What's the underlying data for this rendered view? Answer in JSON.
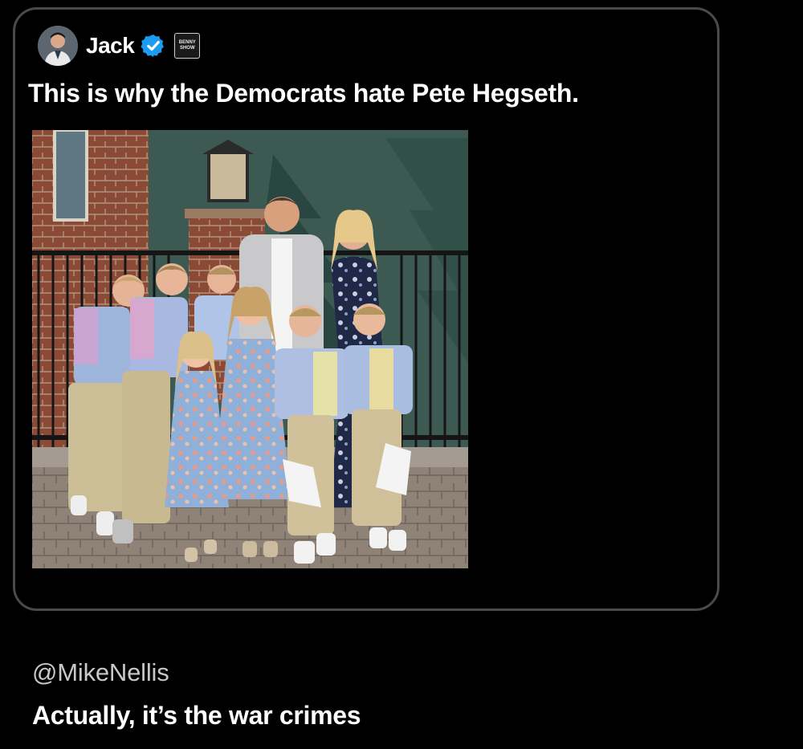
{
  "tweet": {
    "author_name": "Jack",
    "verified": true,
    "avatar_icon": "user-avatar-photo",
    "affiliate_badge_line1": "BENNY",
    "affiliate_badge_line2": "SHOW",
    "text": "This is why the Democrats hate Pete Hegseth.",
    "photo_icon": "family-photo"
  },
  "reply": {
    "handle": "@MikeNellis",
    "text": "Actually, it’s the war crimes"
  },
  "colors": {
    "background": "#000000",
    "card_border": "#4a4a4a",
    "verified_blue": "#1d9bf0",
    "text_primary": "#ffffff",
    "text_secondary": "#c8c8c8"
  }
}
